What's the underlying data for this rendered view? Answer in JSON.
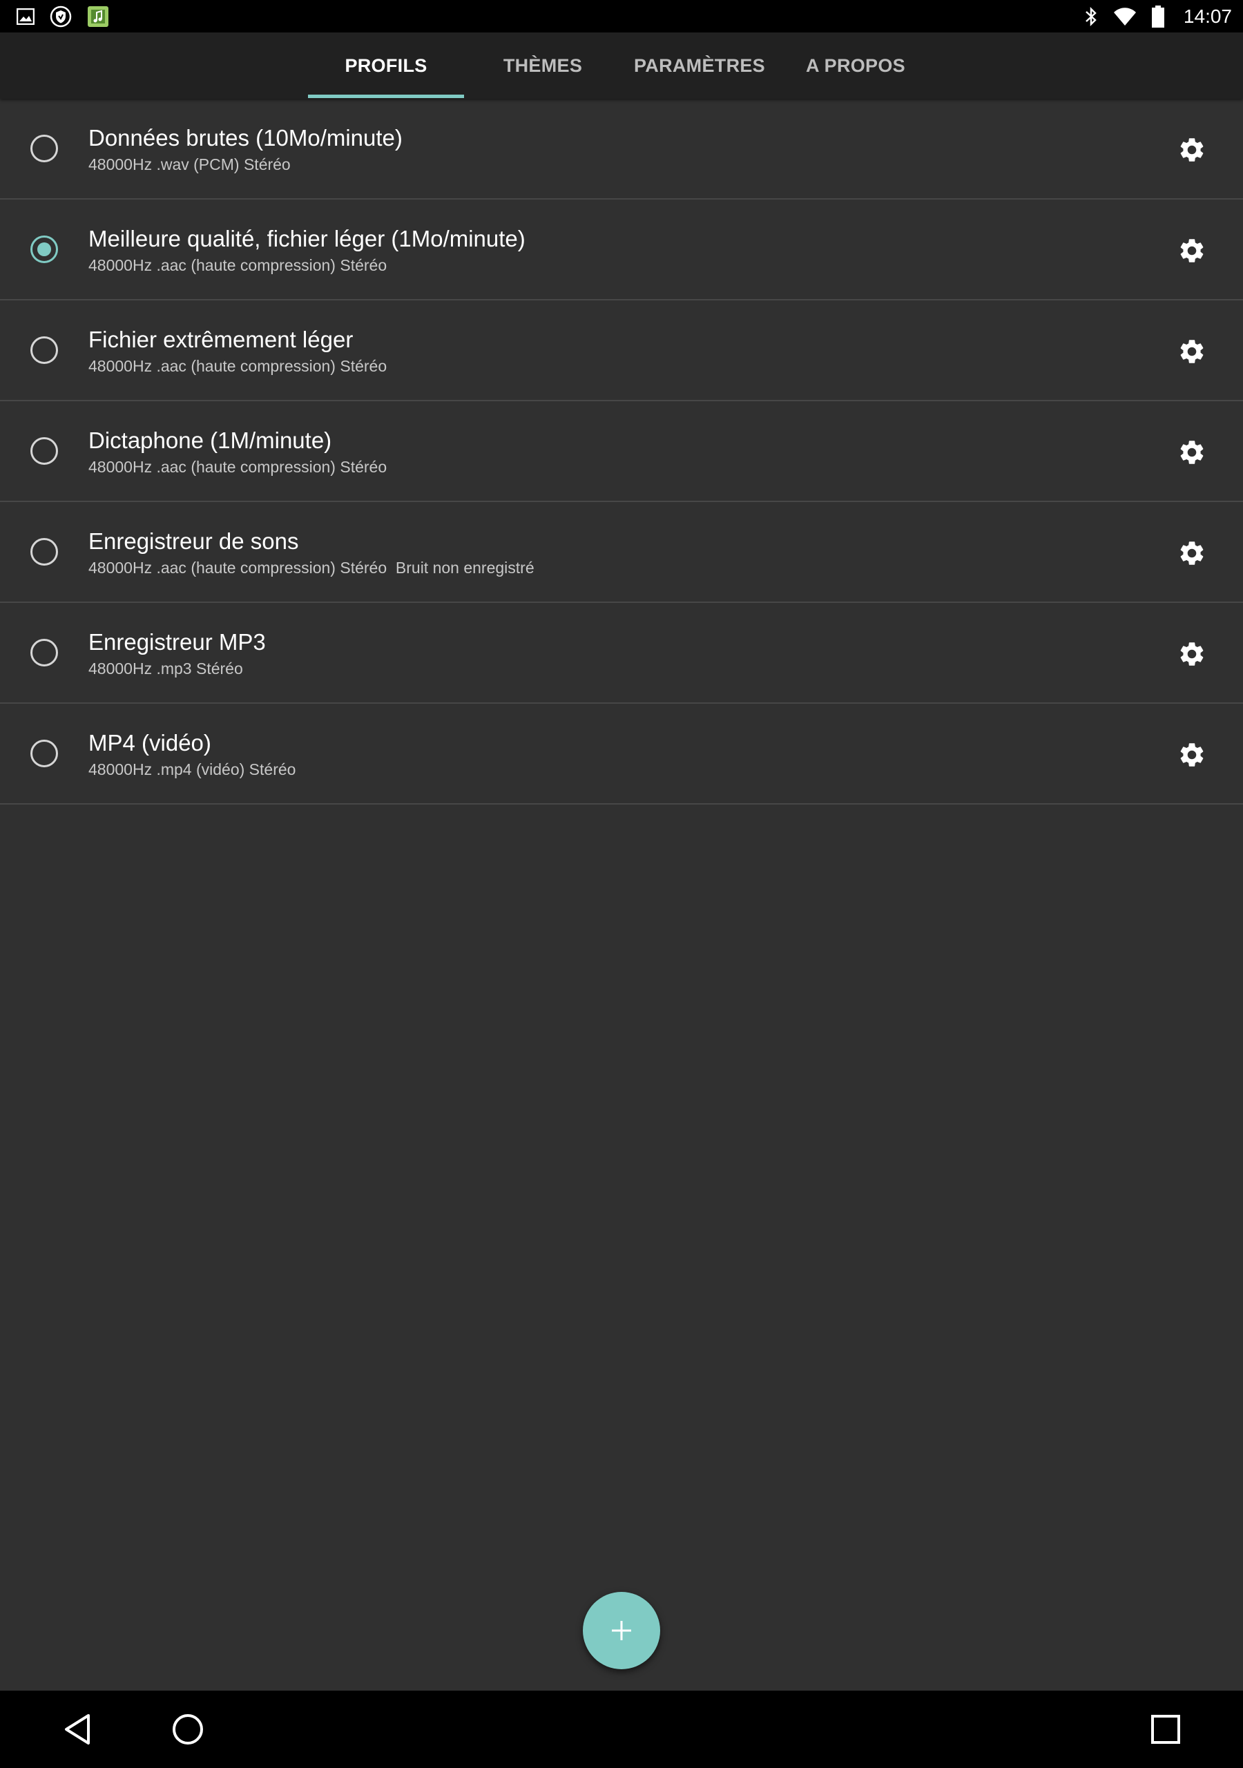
{
  "status_bar": {
    "time": "14:07",
    "left_icons": [
      "gallery-icon",
      "shield-icon",
      "app-icon"
    ],
    "right_icons": [
      "bluetooth-icon",
      "wifi-icon",
      "battery-icon"
    ]
  },
  "tabs": [
    {
      "label": "PROFILS",
      "active": true
    },
    {
      "label": "THÈMES",
      "active": false
    },
    {
      "label": "PARAMÈTRES",
      "active": false
    },
    {
      "label": "A PROPOS",
      "active": false
    }
  ],
  "profiles": [
    {
      "title": "Données brutes (10Mo/minute)",
      "subtitle": "48000Hz .wav (PCM) Stéréo",
      "selected": false
    },
    {
      "title": "Meilleure qualité, fichier léger (1Mo/minute)",
      "subtitle": "48000Hz .aac (haute compression) Stéréo",
      "selected": true
    },
    {
      "title": "Fichier extrêmement léger",
      "subtitle": "48000Hz .aac (haute compression) Stéréo",
      "selected": false
    },
    {
      "title": "Dictaphone (1M/minute)",
      "subtitle": "48000Hz .aac (haute compression) Stéréo",
      "selected": false
    },
    {
      "title": "Enregistreur de sons",
      "subtitle": "48000Hz .aac (haute compression) Stéréo  Bruit non enregistré",
      "selected": false
    },
    {
      "title": "Enregistreur MP3",
      "subtitle": "48000Hz .mp3 Stéréo",
      "selected": false
    },
    {
      "title": "MP4 (vidéo)",
      "subtitle": "48000Hz .mp4 (vidéo) Stéréo",
      "selected": false
    }
  ],
  "fab": {
    "icon": "plus-icon"
  },
  "nav_bar": {
    "icons": [
      "back-icon",
      "home-icon",
      "recents-icon"
    ]
  },
  "colors": {
    "accent": "#80cbc4",
    "background": "#303030",
    "tab_bar": "#212121",
    "system_bars": "#000000"
  }
}
